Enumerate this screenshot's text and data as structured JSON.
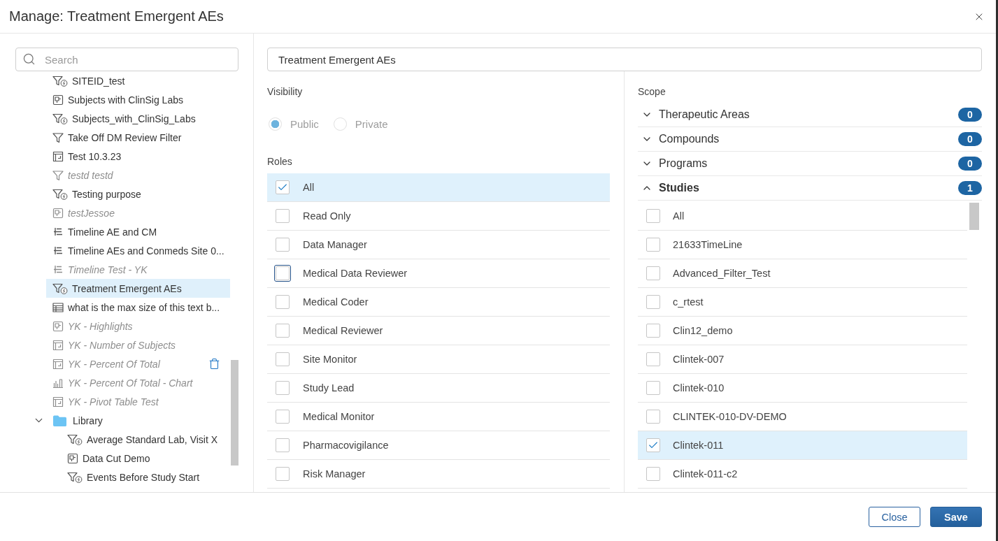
{
  "dialog": {
    "title": "Manage: Treatment Emergent AEs"
  },
  "library_panel": {
    "search": {
      "placeholder": "Search"
    },
    "tree": [
      {
        "label": "SITEID_test",
        "kind": "filter-bolt",
        "muted": false,
        "selected": false,
        "hovered": false
      },
      {
        "label": "Subjects with ClinSig Labs",
        "kind": "panels",
        "muted": false,
        "selected": false,
        "hovered": false
      },
      {
        "label": "Subjects_with_ClinSig_Labs",
        "kind": "filter-bolt",
        "muted": false,
        "selected": false,
        "hovered": false
      },
      {
        "label": "Take Off DM Review Filter",
        "kind": "filter",
        "muted": false,
        "selected": false,
        "hovered": false
      },
      {
        "label": "Test 10.3.23",
        "kind": "pivot",
        "muted": false,
        "selected": false,
        "hovered": false
      },
      {
        "label": "testd testd",
        "kind": "filter",
        "muted": true,
        "selected": false,
        "hovered": false
      },
      {
        "label": "Testing purpose",
        "kind": "filter-bolt",
        "muted": false,
        "selected": false,
        "hovered": false
      },
      {
        "label": "testJessoe",
        "kind": "panels",
        "muted": true,
        "selected": false,
        "hovered": false
      },
      {
        "label": "Timeline AE and CM",
        "kind": "timeline",
        "muted": false,
        "selected": false,
        "hovered": false
      },
      {
        "label": "Timeline AEs and Conmeds Site 0...",
        "kind": "timeline",
        "muted": false,
        "selected": false,
        "hovered": false
      },
      {
        "label": "Timeline Test - YK",
        "kind": "timeline",
        "muted": true,
        "selected": false,
        "hovered": false
      },
      {
        "label": "Treatment Emergent AEs",
        "kind": "filter-bolt",
        "muted": false,
        "selected": true,
        "hovered": false
      },
      {
        "label": "what is the max size of this text b...",
        "kind": "table",
        "muted": false,
        "selected": false,
        "hovered": false
      },
      {
        "label": "YK - Highlights",
        "kind": "panels",
        "muted": true,
        "selected": false,
        "hovered": false
      },
      {
        "label": "YK - Number of Subjects",
        "kind": "pivot",
        "muted": true,
        "selected": false,
        "hovered": false
      },
      {
        "label": "YK - Percent Of Total",
        "kind": "pivot",
        "muted": true,
        "selected": false,
        "hovered": true
      },
      {
        "label": "YK - Percent Of Total - Chart",
        "kind": "chart",
        "muted": true,
        "selected": false,
        "hovered": false
      },
      {
        "label": "YK - Pivot Table Test",
        "kind": "pivot",
        "muted": true,
        "selected": false,
        "hovered": false
      },
      {
        "label": "Library",
        "kind": "folder",
        "muted": false,
        "selected": false,
        "hovered": false,
        "expanded": true,
        "children": [
          {
            "label": "Average Standard Lab, Visit X",
            "kind": "filter-bolt",
            "muted": false,
            "selected": false,
            "hovered": false
          },
          {
            "label": "Data Cut Demo",
            "kind": "panels",
            "muted": false,
            "selected": false,
            "hovered": false
          },
          {
            "label": "Events Before Study Start",
            "kind": "filter-bolt",
            "muted": false,
            "selected": false,
            "hovered": false
          }
        ]
      }
    ]
  },
  "name_field": {
    "value": "Treatment Emergent AEs"
  },
  "visibility": {
    "label": "Visibility",
    "disabled": true,
    "options": [
      {
        "label": "Public",
        "selected": true
      },
      {
        "label": "Private",
        "selected": false
      }
    ]
  },
  "roles": {
    "label": "Roles",
    "items": [
      {
        "label": "All",
        "checked": true,
        "focused": false
      },
      {
        "label": "Read Only",
        "checked": false,
        "focused": false
      },
      {
        "label": "Data Manager",
        "checked": false,
        "focused": false
      },
      {
        "label": "Medical Data Reviewer",
        "checked": false,
        "focused": true
      },
      {
        "label": "Medical Coder",
        "checked": false,
        "focused": false
      },
      {
        "label": "Medical Reviewer",
        "checked": false,
        "focused": false
      },
      {
        "label": "Site Monitor",
        "checked": false,
        "focused": false
      },
      {
        "label": "Study Lead",
        "checked": false,
        "focused": false
      },
      {
        "label": "Medical Monitor",
        "checked": false,
        "focused": false
      },
      {
        "label": "Pharmacovigilance",
        "checked": false,
        "focused": false
      },
      {
        "label": "Risk Manager",
        "checked": false,
        "focused": false
      }
    ]
  },
  "scope": {
    "label": "Scope",
    "groups": [
      {
        "label": "Therapeutic Areas",
        "count": "0",
        "expanded": false
      },
      {
        "label": "Compounds",
        "count": "0",
        "expanded": false
      },
      {
        "label": "Programs",
        "count": "0",
        "expanded": false
      },
      {
        "label": "Studies",
        "count": "1",
        "expanded": true,
        "items": [
          {
            "label": "All",
            "checked": false
          },
          {
            "label": "21633TimeLine",
            "checked": false
          },
          {
            "label": "Advanced_Filter_Test",
            "checked": false
          },
          {
            "label": "c_rtest",
            "checked": false
          },
          {
            "label": "Clin12_demo",
            "checked": false
          },
          {
            "label": "Clintek-007",
            "checked": false
          },
          {
            "label": "Clintek-010",
            "checked": false
          },
          {
            "label": "CLINTEK-010-DV-DEMO",
            "checked": false
          },
          {
            "label": "Clintek-011",
            "checked": true
          },
          {
            "label": "Clintek-011-c2",
            "checked": false
          }
        ]
      }
    ]
  },
  "buttons": [
    {
      "label": "Close",
      "kind": "secondary"
    },
    {
      "label": "Save",
      "kind": "primary"
    }
  ]
}
